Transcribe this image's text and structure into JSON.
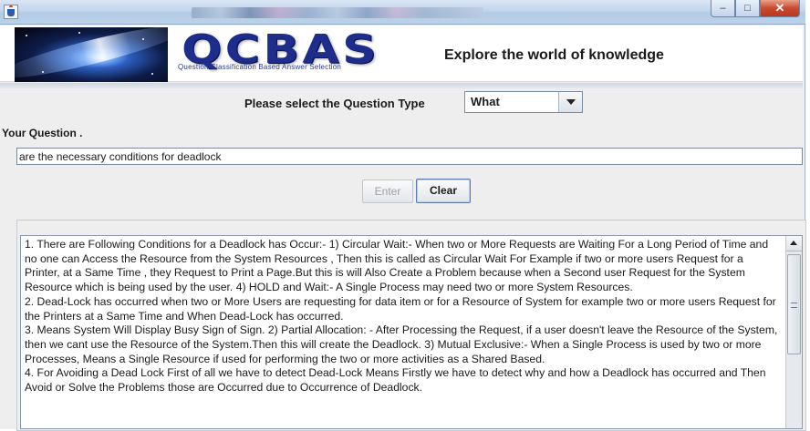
{
  "window": {
    "icon": "java-cup-icon",
    "controls": {
      "minimize": "–",
      "maximize": "□",
      "close": "✕"
    }
  },
  "banner": {
    "logo_title": "QCBAS",
    "logo_subtitle": "Question Classification Based Answer Selection",
    "tagline": "Explore the world of knowledge"
  },
  "form": {
    "question_type_label": "Please select the Question Type",
    "question_type_value": "What",
    "your_question_label": "Your Question .",
    "question_value": "are the necessary conditions for deadlock",
    "enter_label": "Enter",
    "clear_label": "Clear"
  },
  "answer": {
    "text": "1. There are Following Conditions for a Deadlock has Occur:- 1) Circular Wait:- When two or More Requests are Waiting For a Long Period of Time and no one can Access the Resource from the System Resources , Then this is called as Circular Wait For Example if two or more users Request for a Printer, at a Same Time , they Request to Print a Page.But this is will Also Create a Problem because when a Second user Request for the System Resource which is being used by the user. 4) HOLD and Wait:- A Single Process may need two or more System Resources.\n2. Dead-Lock has occurred when two or More Users are requesting for data item or for a Resource of System for example two or more users Request for the Printers at a Same Time and When Dead-Lock has occurred.\n3. Means System Will Display Busy Sign of Sign. 2) Partial Allocation: - After Processing the Request, if a user doesn't leave the Resource of the System, then we cant use the Resource of the System.Then this will create the Deadlock. 3) Mutual Exclusive:- When a Single Process is used by two or more Processes, Means a Single Resource if used for performing the two or more activities as a Shared Based.\n4. For Avoiding a Dead Lock First of all we have to detect Dead-Lock Means Firstly we have to detect why and how a Deadlock has occurred and Then Avoid or Solve the Problems those are Occurred due to Occurrence of Deadlock."
  }
}
